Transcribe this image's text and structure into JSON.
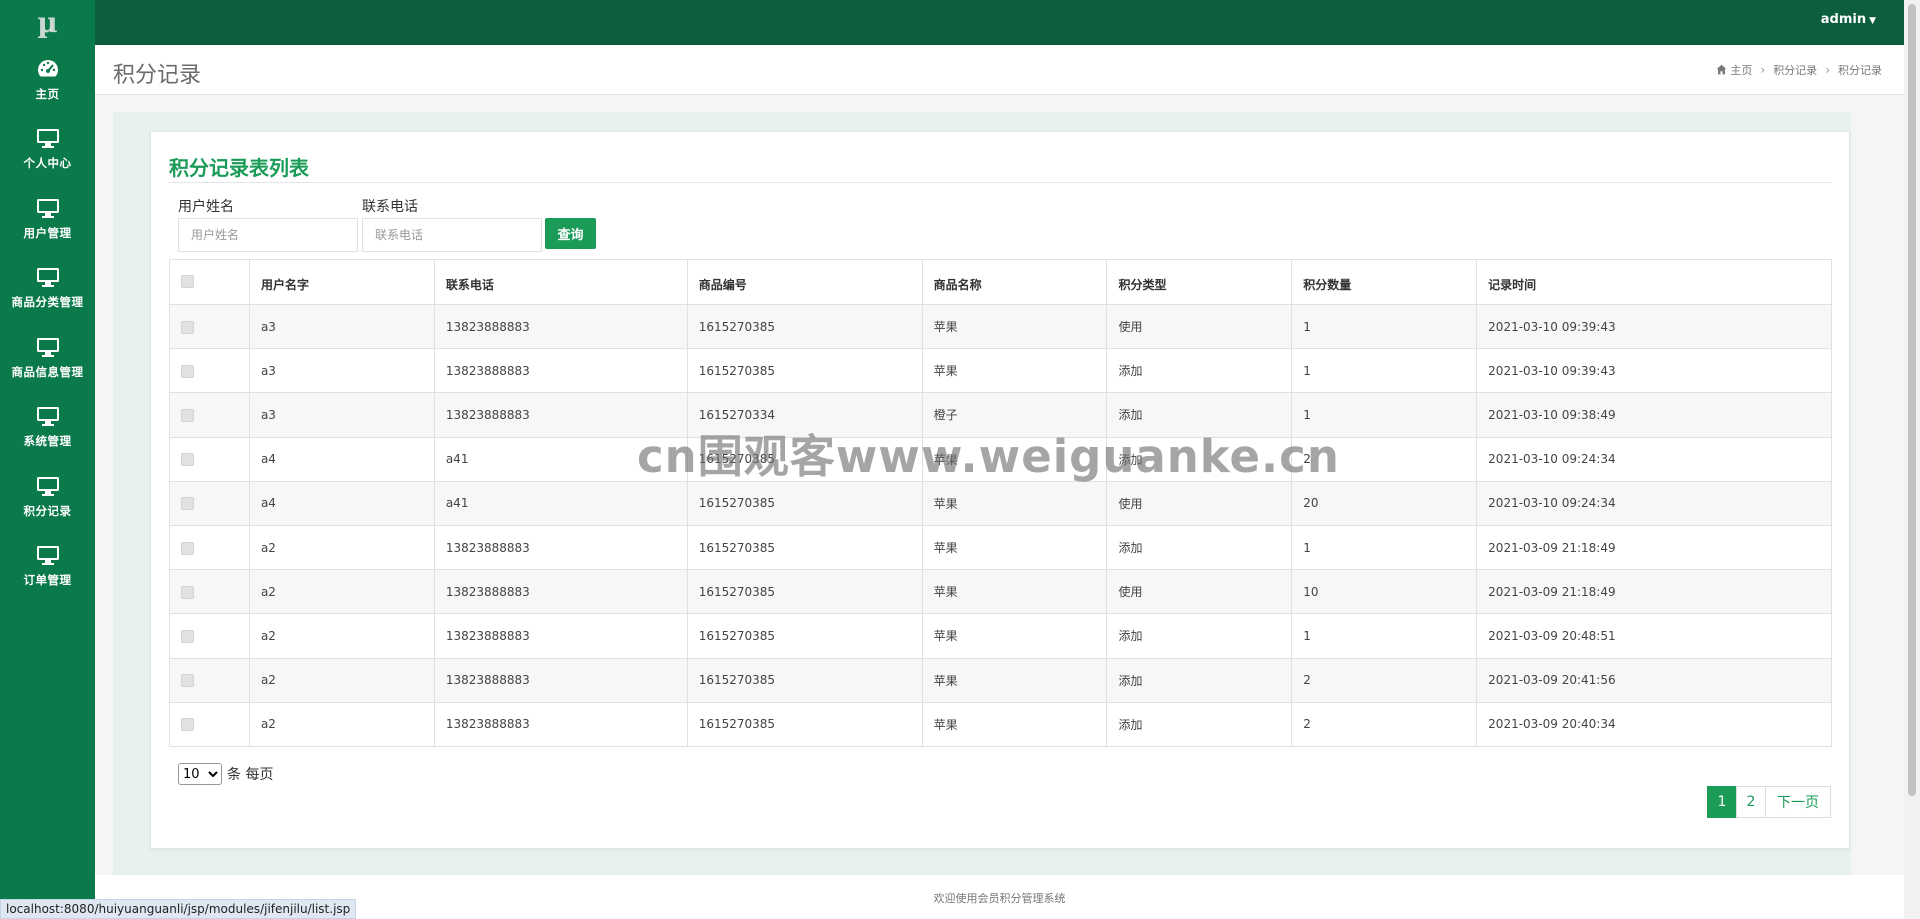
{
  "app": {
    "logo": "µ",
    "user": "admin"
  },
  "sidebar": {
    "items": [
      {
        "label": "主页",
        "icon": "dashboard-icon"
      },
      {
        "label": "个人中心",
        "icon": "monitor-icon"
      },
      {
        "label": "用户管理",
        "icon": "monitor-icon"
      },
      {
        "label": "商品分类管理",
        "icon": "monitor-icon"
      },
      {
        "label": "商品信息管理",
        "icon": "monitor-icon"
      },
      {
        "label": "系统管理",
        "icon": "monitor-icon"
      },
      {
        "label": "积分记录",
        "icon": "monitor-icon"
      },
      {
        "label": "订单管理",
        "icon": "monitor-icon"
      }
    ]
  },
  "header": {
    "title": "积分记录",
    "breadcrumb": [
      "主页",
      "积分记录",
      "积分记录"
    ]
  },
  "card": {
    "title": "积分记录表列表"
  },
  "search": {
    "name_label": "用户姓名",
    "name_placeholder": "用户姓名",
    "phone_label": "联系电话",
    "phone_placeholder": "联系电话",
    "button": "查询"
  },
  "table": {
    "columns": [
      "用户名字",
      "联系电话",
      "商品编号",
      "商品名称",
      "积分类型",
      "积分数量",
      "记录时间"
    ],
    "rows": [
      [
        "a3",
        "13823888883",
        "1615270385",
        "苹果",
        "使用",
        "1",
        "2021-03-10 09:39:43"
      ],
      [
        "a3",
        "13823888883",
        "1615270385",
        "苹果",
        "添加",
        "1",
        "2021-03-10 09:39:43"
      ],
      [
        "a3",
        "13823888883",
        "1615270334",
        "橙子",
        "添加",
        "1",
        "2021-03-10 09:38:49"
      ],
      [
        "a4",
        "a41",
        "1615270385",
        "苹果",
        "添加",
        "2",
        "2021-03-10 09:24:34"
      ],
      [
        "a4",
        "a41",
        "1615270385",
        "苹果",
        "使用",
        "20",
        "2021-03-10 09:24:34"
      ],
      [
        "a2",
        "13823888883",
        "1615270385",
        "苹果",
        "添加",
        "1",
        "2021-03-09 21:18:49"
      ],
      [
        "a2",
        "13823888883",
        "1615270385",
        "苹果",
        "使用",
        "10",
        "2021-03-09 21:18:49"
      ],
      [
        "a2",
        "13823888883",
        "1615270385",
        "苹果",
        "添加",
        "1",
        "2021-03-09 20:48:51"
      ],
      [
        "a2",
        "13823888883",
        "1615270385",
        "苹果",
        "添加",
        "2",
        "2021-03-09 20:41:56"
      ],
      [
        "a2",
        "13823888883",
        "1615270385",
        "苹果",
        "添加",
        "2",
        "2021-03-09 20:40:34"
      ]
    ]
  },
  "pagination": {
    "per_page_value": "10",
    "per_page_suffix": "条 每页",
    "pages": [
      "1",
      "2"
    ],
    "current": "1",
    "next": "下一页"
  },
  "watermark": "cn围观客www.weiguanke.cn",
  "footer": "欢迎使用会员积分管理系统",
  "status_url": "localhost:8080/huiyuanguanli/jsp/modules/jifenjilu/list.jsp",
  "colors": {
    "brand_dark": "#0d5e3e",
    "brand": "#0a7a4b",
    "accent": "#1a9b58"
  }
}
